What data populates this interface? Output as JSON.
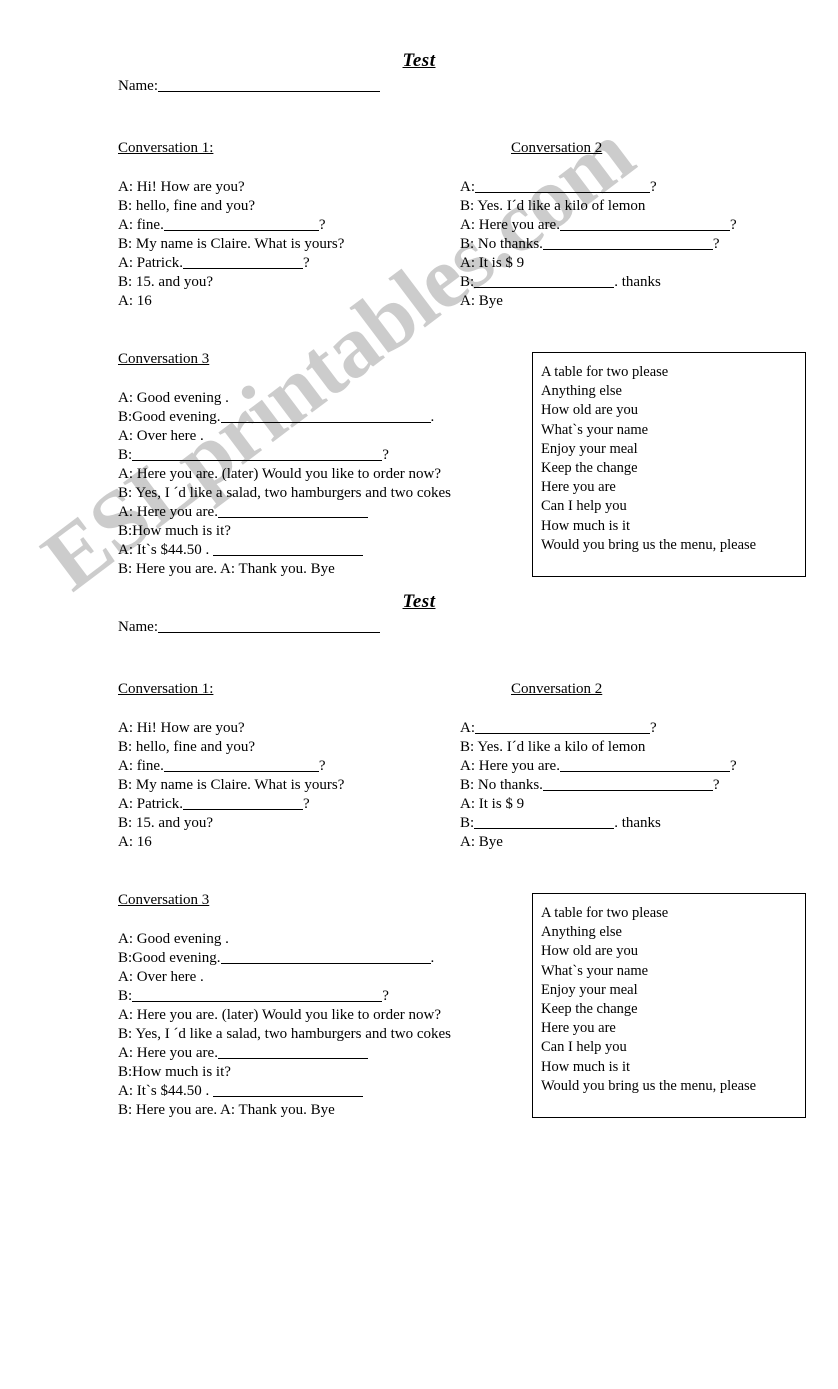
{
  "document": {
    "title": "Test",
    "name_label": "Name:",
    "watermark": "ESLprintables.com",
    "watermark_color": "#cccccc",
    "copies": 2
  },
  "conversation_1": {
    "heading": "Conversation 1:",
    "lines": [
      {
        "speaker": "A:",
        "before": " Hi! How are you?",
        "blank": null,
        "after": ""
      },
      {
        "speaker": "B:",
        "before": " hello, fine and you?",
        "blank": null,
        "after": ""
      },
      {
        "speaker": "A:",
        "before": " fine.",
        "blank": "w155",
        "after": "?"
      },
      {
        "speaker": "B:",
        "before": " My name is Claire. What is yours?",
        "blank": null,
        "after": ""
      },
      {
        "speaker": "A:",
        "before": " Patrick.",
        "blank": "w120",
        "after": "?"
      },
      {
        "speaker": "B:",
        "before": " 15. and you?",
        "blank": null,
        "after": ""
      },
      {
        "speaker": "A:",
        "before": " 16",
        "blank": null,
        "after": ""
      }
    ]
  },
  "conversation_2": {
    "heading": "Conversation 2",
    "lines": [
      {
        "speaker": "A:",
        "before": "",
        "blank": "w175",
        "after": "?"
      },
      {
        "speaker": "B:",
        "before": " Yes. I´d like a kilo of lemon",
        "blank": null,
        "after": ""
      },
      {
        "speaker": "A:",
        "before": " Here you are.",
        "blank": "w170",
        "after": "?"
      },
      {
        "speaker": "B:",
        "before": " No thanks.",
        "blank": "w170",
        "after": "?"
      },
      {
        "speaker": "A:",
        "before": " It is $ 9",
        "blank": null,
        "after": ""
      },
      {
        "speaker": "B:",
        "before": "",
        "blank": "w140",
        "after": ". thanks"
      },
      {
        "speaker": "A:",
        "before": " Bye",
        "blank": null,
        "after": ""
      }
    ]
  },
  "conversation_3": {
    "heading": "Conversation 3",
    "lines": [
      {
        "speaker": "A:",
        "before": " Good evening .",
        "blank": null,
        "after": ""
      },
      {
        "speaker": "B:",
        "before": "Good evening.",
        "blank": "w210",
        "after": "."
      },
      {
        "speaker": "A:",
        "before": " Over here .",
        "blank": null,
        "after": ""
      },
      {
        "speaker": "B:",
        "before": "",
        "blank": "w250",
        "after": "?"
      },
      {
        "speaker": "A:",
        "before": " Here you are. (later) Would you like to order now?",
        "blank": null,
        "after": ""
      },
      {
        "speaker": "B:",
        "before": " Yes, I ´d like a salad, two hamburgers and two cokes",
        "blank": null,
        "after": ""
      },
      {
        "speaker": "A:",
        "before": " Here you are.",
        "blank": "w150",
        "after": ""
      },
      {
        "speaker": "B:",
        "before": "How much is it?",
        "blank": null,
        "after": ""
      },
      {
        "speaker": "A:",
        "before": " It`s $44.50 . ",
        "blank": "w150",
        "after": ""
      },
      {
        "speaker": "B:",
        "before": "  Here you are. A: Thank you. Bye",
        "blank": null,
        "after": ""
      }
    ]
  },
  "phrase_box": {
    "phrases": [
      "A table for two please",
      "Anything else",
      "How old are you",
      "What`s your name",
      " Enjoy your meal",
      "Keep the change",
      "Here you are",
      "Can I help you",
      "How much is it",
      "Would you bring us the menu, please"
    ]
  }
}
